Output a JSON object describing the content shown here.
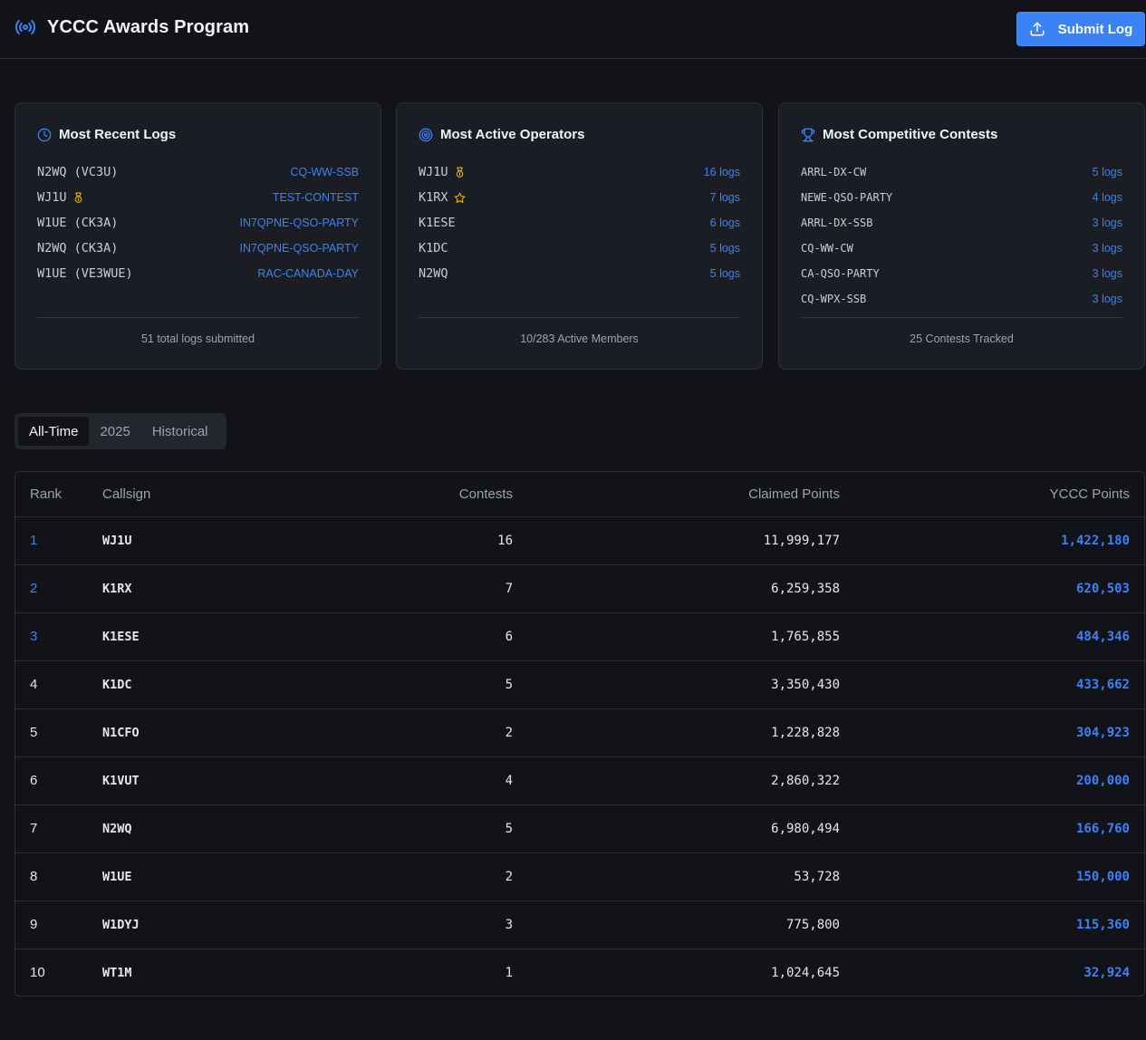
{
  "header": {
    "title": "YCCC Awards Program",
    "submit_label": "Submit Log",
    "accent": "#3b82f6"
  },
  "cards": {
    "recent": {
      "title": "Most Recent Logs",
      "icon": "clock-icon",
      "items": [
        {
          "call": "N2WQ (VC3U)",
          "link": "CQ-WW-SSB"
        },
        {
          "call": "WJ1U",
          "badge": "medal-icon",
          "link": "TEST-CONTEST"
        },
        {
          "call": "W1UE (CK3A)",
          "link": "IN7QPNE-QSO-PARTY"
        },
        {
          "call": "N2WQ (CK3A)",
          "link": "IN7QPNE-QSO-PARTY"
        },
        {
          "call": "W1UE (VE3WUE)",
          "link": "RAC-CANADA-DAY"
        }
      ],
      "footer": "51 total logs submitted"
    },
    "active": {
      "title": "Most Active Operators",
      "icon": "target-icon",
      "items": [
        {
          "call": "WJ1U",
          "badge": "medal-icon",
          "count": "16 logs"
        },
        {
          "call": "K1RX",
          "badge": "star-icon",
          "count": "7 logs"
        },
        {
          "call": "K1ESE",
          "count": "6 logs"
        },
        {
          "call": "K1DC",
          "count": "5 logs"
        },
        {
          "call": "N2WQ",
          "count": "5 logs"
        }
      ],
      "footer": "10/283 Active Members"
    },
    "competitive": {
      "title": "Most Competitive Contests",
      "icon": "trophy-icon",
      "items": [
        {
          "name": "ARRL-DX-CW",
          "count": "5 logs"
        },
        {
          "name": "NEWE-QSO-PARTY",
          "count": "4 logs"
        },
        {
          "name": "ARRL-DX-SSB",
          "count": "3 logs"
        },
        {
          "name": "CQ-WW-CW",
          "count": "3 logs"
        },
        {
          "name": "CA-QSO-PARTY",
          "count": "3 logs"
        },
        {
          "name": "CQ-WPX-SSB",
          "count": "3 logs"
        }
      ],
      "footer": "25 Contests Tracked"
    }
  },
  "tabs": [
    {
      "label": "All-Time",
      "active": true
    },
    {
      "label": "2025",
      "active": false
    },
    {
      "label": "Historical",
      "active": false
    }
  ],
  "table": {
    "columns": [
      "Rank",
      "Callsign",
      "Contests",
      "Claimed Points",
      "YCCC Points"
    ],
    "rows": [
      {
        "rank": "1",
        "call": "WJ1U",
        "contests": "16",
        "claimed": "11,999,177",
        "yccc": "1,422,180"
      },
      {
        "rank": "2",
        "call": "K1RX",
        "contests": "7",
        "claimed": "6,259,358",
        "yccc": "620,503"
      },
      {
        "rank": "3",
        "call": "K1ESE",
        "contests": "6",
        "claimed": "1,765,855",
        "yccc": "484,346"
      },
      {
        "rank": "4",
        "call": "K1DC",
        "contests": "5",
        "claimed": "3,350,430",
        "yccc": "433,662"
      },
      {
        "rank": "5",
        "call": "N1CFO",
        "contests": "2",
        "claimed": "1,228,828",
        "yccc": "304,923"
      },
      {
        "rank": "6",
        "call": "K1VUT",
        "contests": "4",
        "claimed": "2,860,322",
        "yccc": "200,000"
      },
      {
        "rank": "7",
        "call": "N2WQ",
        "contests": "5",
        "claimed": "6,980,494",
        "yccc": "166,760"
      },
      {
        "rank": "8",
        "call": "W1UE",
        "contests": "2",
        "claimed": "53,728",
        "yccc": "150,000"
      },
      {
        "rank": "9",
        "call": "W1DYJ",
        "contests": "3",
        "claimed": "775,800",
        "yccc": "115,360"
      },
      {
        "rank": "10",
        "call": "WT1M",
        "contests": "1",
        "claimed": "1,024,645",
        "yccc": "32,924"
      }
    ]
  }
}
